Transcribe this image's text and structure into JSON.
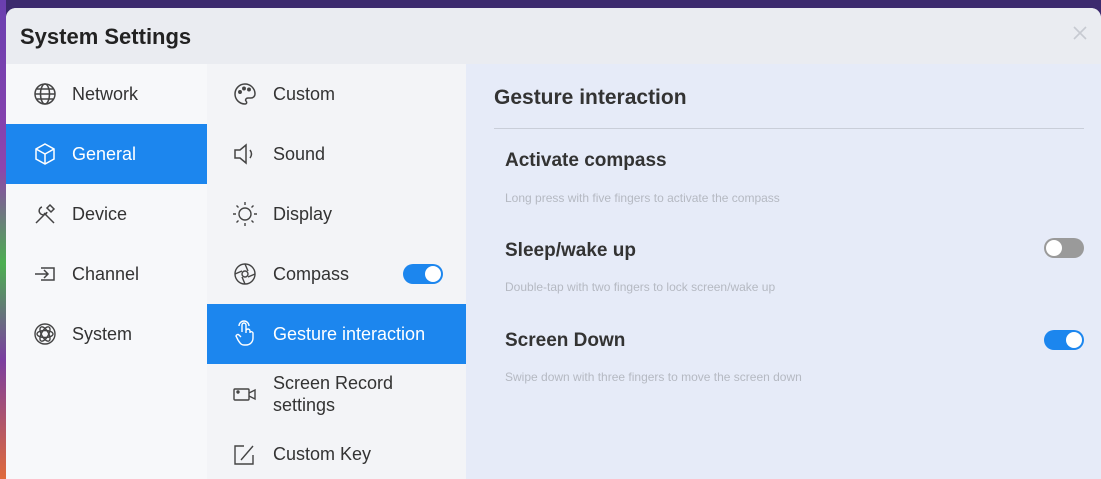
{
  "window": {
    "title": "System Settings"
  },
  "categories": [
    {
      "label": "Network",
      "icon": "globe-icon",
      "active": false
    },
    {
      "label": "General",
      "icon": "cube-icon",
      "active": true
    },
    {
      "label": "Device",
      "icon": "tools-icon",
      "active": false
    },
    {
      "label": "Channel",
      "icon": "input-icon",
      "active": false
    },
    {
      "label": "System",
      "icon": "atom-icon",
      "active": false
    }
  ],
  "subitems": [
    {
      "label": "Custom",
      "icon": "palette-icon",
      "active": false
    },
    {
      "label": "Sound",
      "icon": "speaker-icon",
      "active": false
    },
    {
      "label": "Display",
      "icon": "sun-icon",
      "active": false
    },
    {
      "label": "Compass",
      "icon": "compass-icon",
      "active": false,
      "toggle": true
    },
    {
      "label": "Gesture interaction",
      "icon": "hand-pointer-icon",
      "active": true
    },
    {
      "label_line1": "Screen Record",
      "label_line2": "settings",
      "icon": "video-camera-icon",
      "active": false
    },
    {
      "label": "Custom Key",
      "icon": "edit-icon",
      "active": false
    }
  ],
  "content": {
    "section_title": "Gesture interaction",
    "options": [
      {
        "title": "Activate compass",
        "description": "Long press with five fingers to activate the compass"
      },
      {
        "title": "Sleep/wake up",
        "description": "Double-tap with two fingers to lock screen/wake up",
        "toggle": false
      },
      {
        "title": "Screen Down",
        "description": "Swipe down with three fingers to move the screen down",
        "toggle": true
      }
    ]
  },
  "colors": {
    "accent": "#1c86ee",
    "panel": "#f3f4f7",
    "content_bg": "#e6ebf8"
  }
}
